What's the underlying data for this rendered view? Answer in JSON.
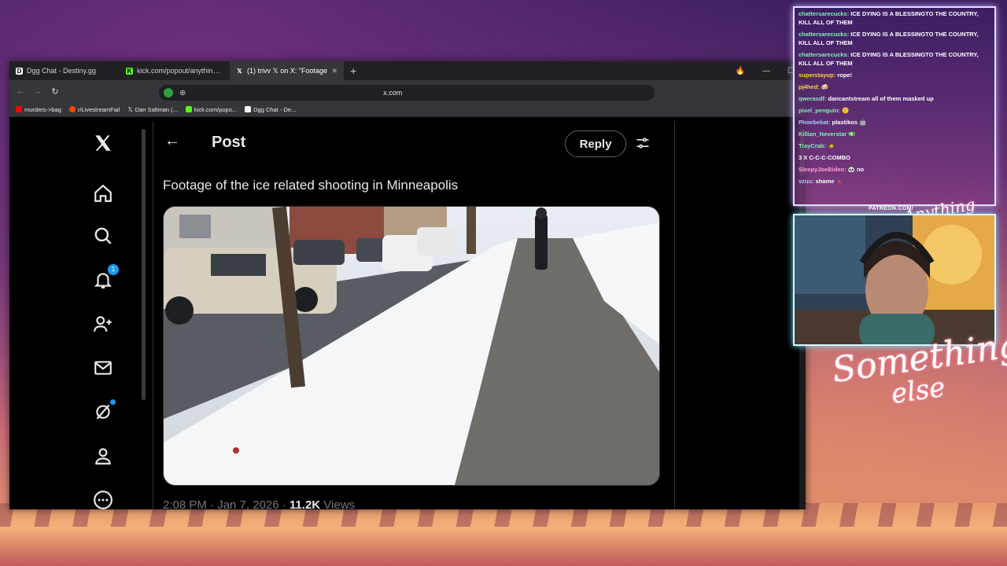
{
  "browser": {
    "tabs": [
      {
        "title": "Dgg Chat - Destiny.gg",
        "icon": "destiny-icon",
        "active": false
      },
      {
        "title": "kick.com/popout/anythingelse/chat",
        "icon": "kick-icon",
        "active": false
      },
      {
        "title": "(1) trivv 𝕏 on X: \"Footage",
        "icon": "x-icon",
        "active": true
      }
    ],
    "url": "x.com",
    "bookmarks": [
      {
        "label": "murders->bag",
        "icon": "youtube-icon",
        "color": "#ff0000"
      },
      {
        "label": "r/LivestreamFail",
        "icon": "reddit-icon",
        "color": "#ff4500"
      },
      {
        "label": "Dan Saltman (...",
        "icon": "x-icon",
        "color": "#ffffff"
      },
      {
        "label": "kick.com/popo...",
        "icon": "kick-icon",
        "color": "#53fc18"
      },
      {
        "label": "Dgg Chat - De...",
        "icon": "destiny-icon",
        "color": "#ffffff"
      }
    ]
  },
  "x": {
    "header_title": "Post",
    "reply_label": "Reply",
    "notification_count": "1",
    "post_text": "Footage of the ice related shooting in Minneapolis",
    "post_time": "2:08 PM · Jan 7, 2026 · ",
    "views_count": "11.2K",
    "views_label": " Views"
  },
  "chat": {
    "messages": [
      {
        "user": "chattersarecucks:",
        "text": " ICE DYING IS A BLESSINGTO THE COUNTRY, KILL ALL OF THEM",
        "color": "u"
      },
      {
        "user": "chattersarecucks:",
        "text": " ICE DYING IS A BLESSINGTO THE COUNTRY, KILL ALL OF THEM",
        "color": "u"
      },
      {
        "user": "chattersarecucks:",
        "text": " ICE DYING IS A BLESSINGTO THE COUNTRY, KILL ALL OF THEM",
        "color": "u"
      },
      {
        "user": "superstayup:",
        "text": " rope!",
        "color": "u y"
      },
      {
        "user": "pj4hed:",
        "text": " 🍻",
        "color": "u y"
      },
      {
        "user": "qwerasdf:",
        "text": " dancantstream all of them masked up",
        "color": "u"
      },
      {
        "user": "pixel_penguin:",
        "text": " 🙂",
        "color": "u"
      },
      {
        "user": "Phoebekat:",
        "text": " plastikos 🤖",
        "color": "u b"
      },
      {
        "user": "Killian_Neverstar",
        "text": " 💵",
        "color": "u"
      },
      {
        "user": "TrayCrab:",
        "text": " 🧔",
        "color": "u"
      },
      {
        "user": "",
        "text": "3 X C-C-C-COMBO",
        "color": "u"
      },
      {
        "user": "SleepyJoeBiden:",
        "text": " 🐼 no",
        "color": "u p"
      },
      {
        "user": "vzuu:",
        "text": " shame 🔺",
        "color": "u b"
      }
    ],
    "patreon": "PATREON.COM/",
    "logo_small": "Anything else"
  },
  "brand": {
    "line1": "Something",
    "line2": "else"
  }
}
